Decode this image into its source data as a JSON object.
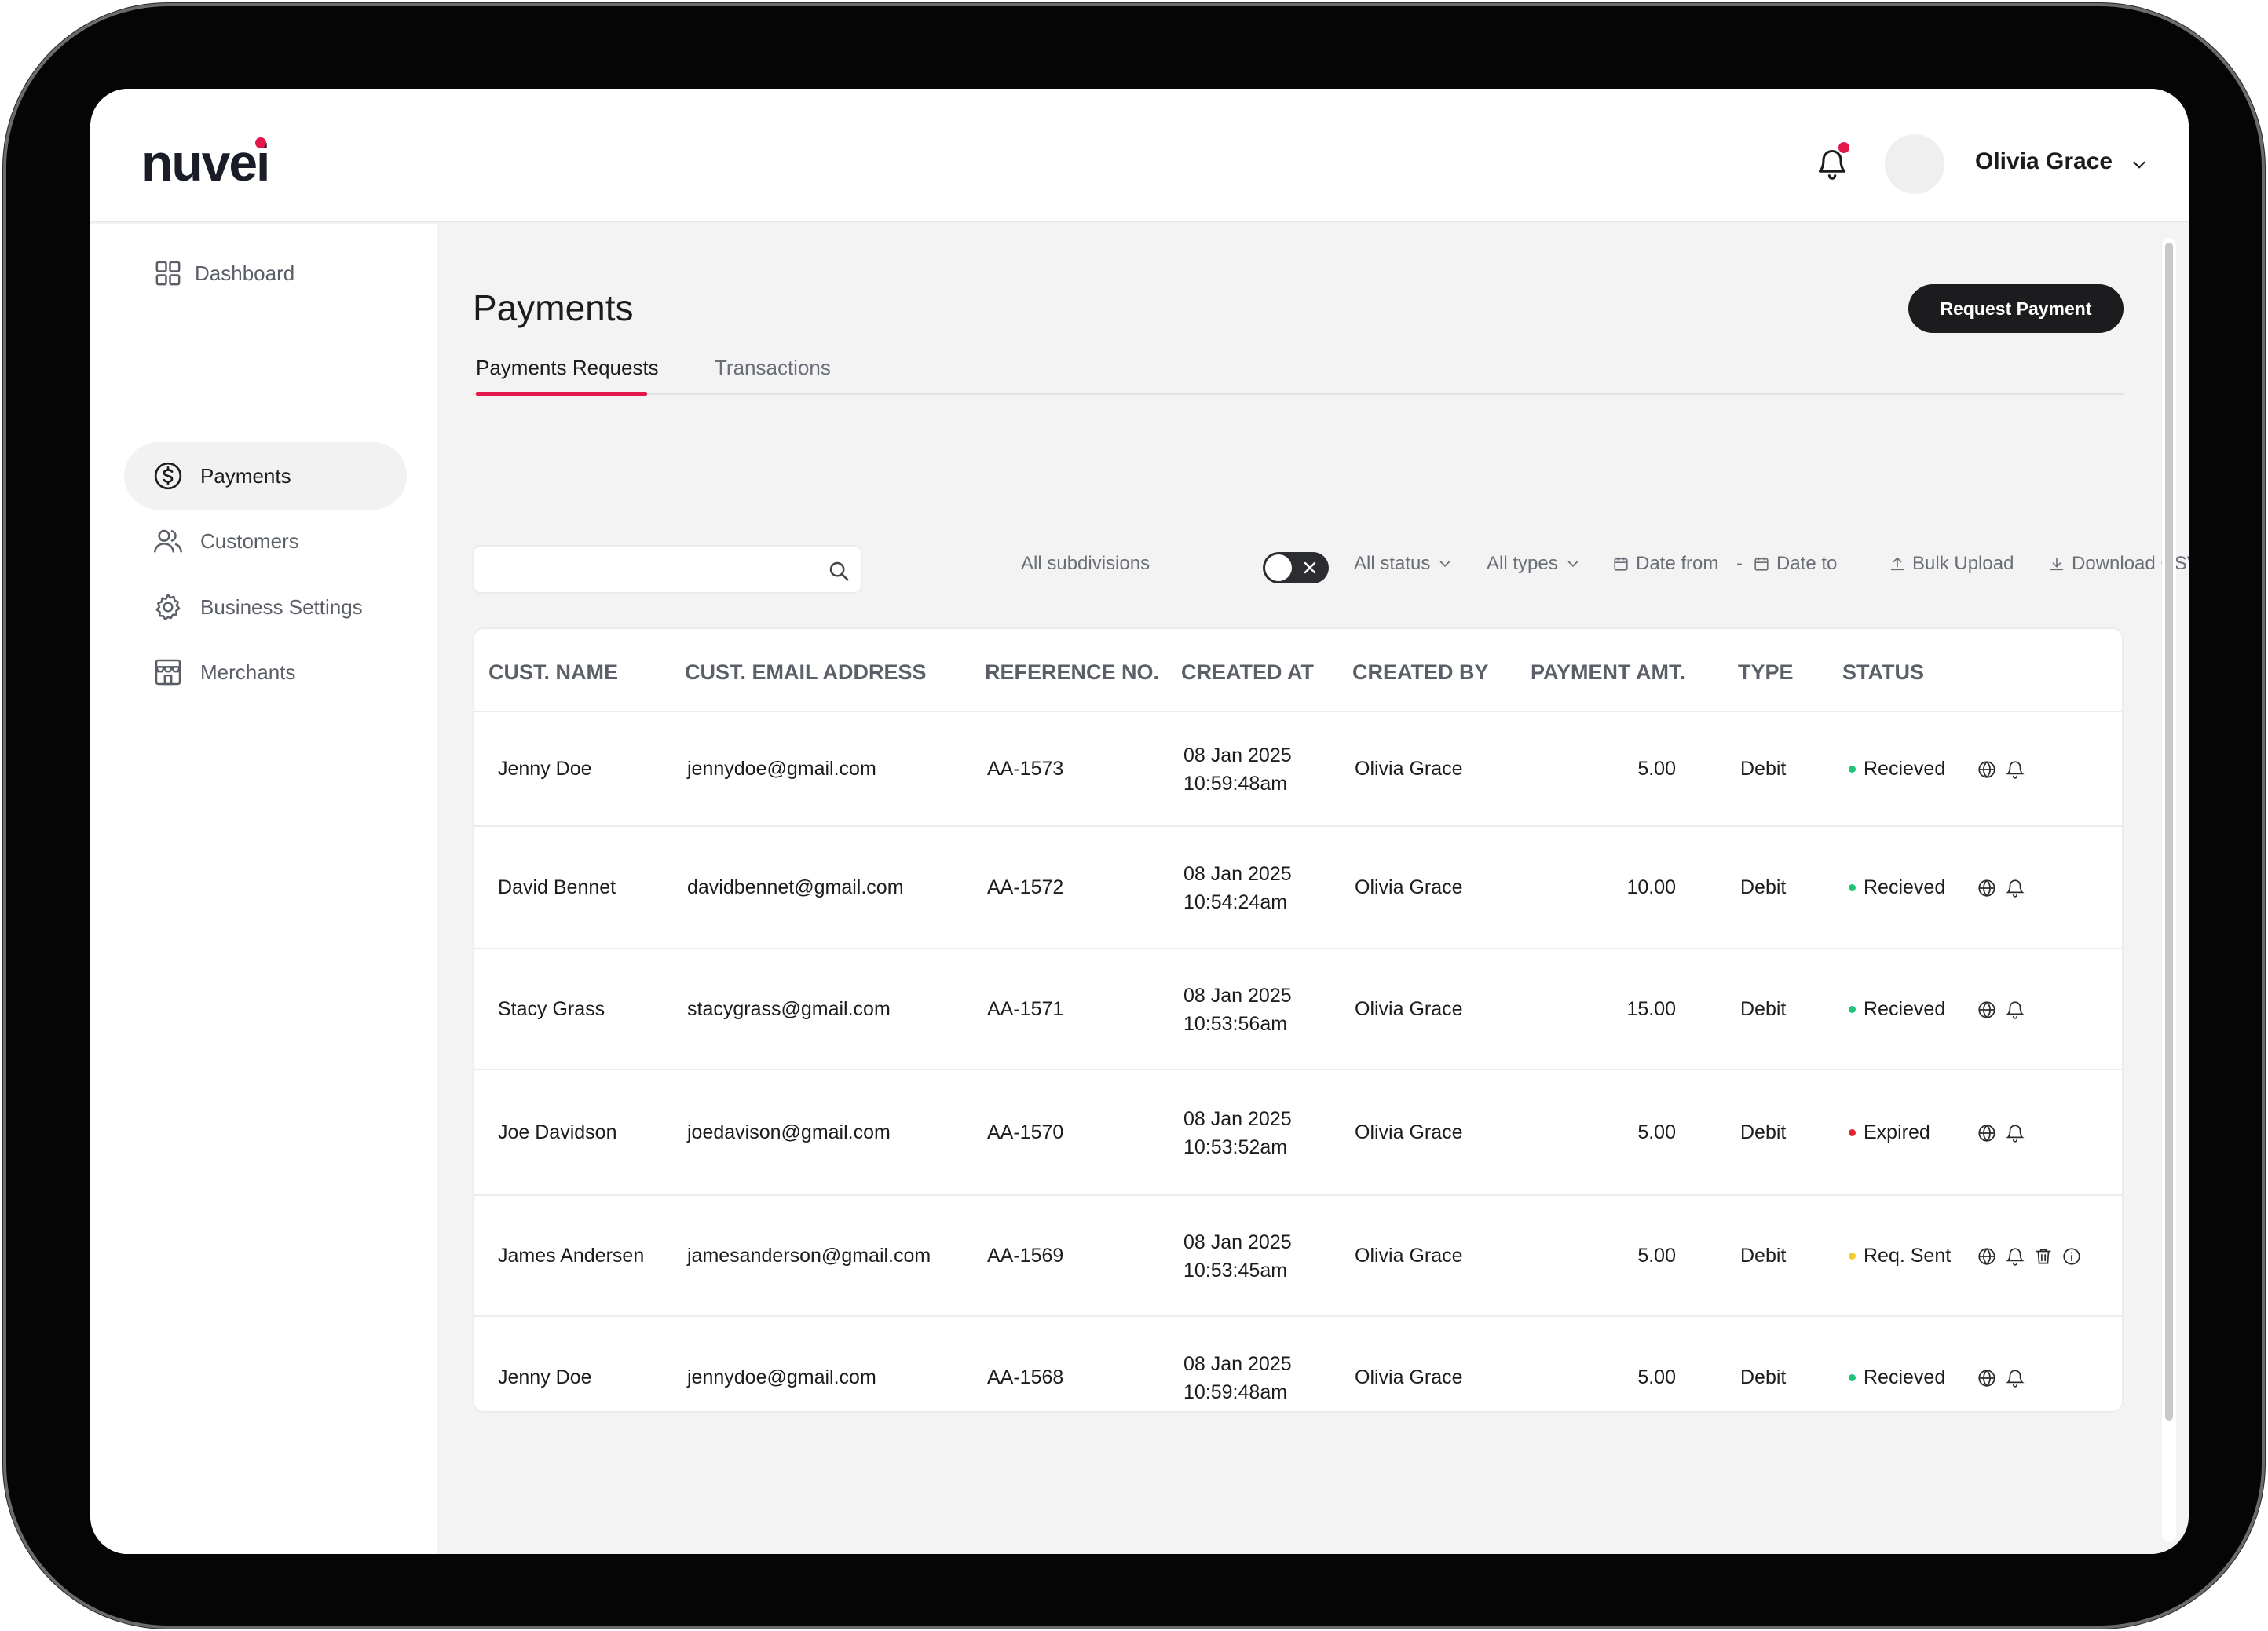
{
  "brand": {
    "logo_text": "nuvei",
    "accent": "#e4174a"
  },
  "header": {
    "user_name": "Olivia Grace",
    "bell_icon": "bell-icon",
    "dropdown_icon": "chevron-down-icon"
  },
  "sidebar": {
    "items": [
      {
        "label": "Dashboard",
        "icon": "grid-icon",
        "active": false
      },
      {
        "label": "Payments",
        "icon": "dollar-circle-icon",
        "active": true
      },
      {
        "label": "Customers",
        "icon": "users-icon",
        "active": false
      },
      {
        "label": "Business Settings",
        "icon": "gear-icon",
        "active": false
      },
      {
        "label": "Merchants",
        "icon": "store-icon",
        "active": false
      }
    ]
  },
  "main": {
    "title": "Payments",
    "request_button": "Request Payment",
    "tabs": [
      {
        "label": "Payments Requests",
        "active": true
      },
      {
        "label": "Transactions",
        "active": false
      }
    ],
    "search": {
      "value": "",
      "placeholder": ""
    },
    "filters": {
      "subdivisions": "All subdivisions",
      "status": "All status",
      "types": "All types",
      "date_from": "Date from",
      "date_sep": "-",
      "date_to": "Date to",
      "bulk_upload": "Bulk Upload",
      "download_csv": "Download CSV"
    }
  },
  "table": {
    "columns": [
      "CUST. NAME",
      "CUST. EMAIL ADDRESS",
      "REFERENCE NO.",
      "CREATED AT",
      "CREATED BY",
      "PAYMENT AMT.",
      "TYPE",
      "STATUS"
    ],
    "status_colors": {
      "Recieved": "#1fc47a",
      "Expired": "#e4232f",
      "Req. Sent": "#f2cc2f"
    },
    "rows": [
      {
        "name": "Jenny Doe",
        "email": "jennydoe@gmail.com",
        "ref": "AA-1573",
        "date": "08 Jan 2025",
        "time": "10:59:48am",
        "by": "Olivia Grace",
        "amount": "5.00",
        "type": "Debit",
        "status": "Recieved"
      },
      {
        "name": "David Bennet",
        "email": "davidbennet@gmail.com",
        "ref": "AA-1572",
        "date": "08 Jan 2025",
        "time": "10:54:24am",
        "by": "Olivia Grace",
        "amount": "10.00",
        "type": "Debit",
        "status": "Recieved"
      },
      {
        "name": "Stacy Grass",
        "email": "stacygrass@gmail.com",
        "ref": "AA-1571",
        "date": "08 Jan 2025",
        "time": "10:53:56am",
        "by": "Olivia Grace",
        "amount": "15.00",
        "type": "Debit",
        "status": "Recieved"
      },
      {
        "name": "Joe Davidson",
        "email": "joedavison@gmail.com",
        "ref": "AA-1570",
        "date": "08 Jan 2025",
        "time": "10:53:52am",
        "by": "Olivia Grace",
        "amount": "5.00",
        "type": "Debit",
        "status": "Expired"
      },
      {
        "name": "James Andersen",
        "email": "jamesanderson@gmail.com",
        "ref": "AA-1569",
        "date": "08 Jan 2025",
        "time": "10:53:45am",
        "by": "Olivia Grace",
        "amount": "5.00",
        "type": "Debit",
        "status": "Req. Sent"
      },
      {
        "name": "Jenny Doe",
        "email": "jennydoe@gmail.com",
        "ref": "AA-1568",
        "date": "08 Jan 2025",
        "time": "10:59:48am",
        "by": "Olivia Grace",
        "amount": "5.00",
        "type": "Debit",
        "status": "Recieved"
      }
    ]
  }
}
